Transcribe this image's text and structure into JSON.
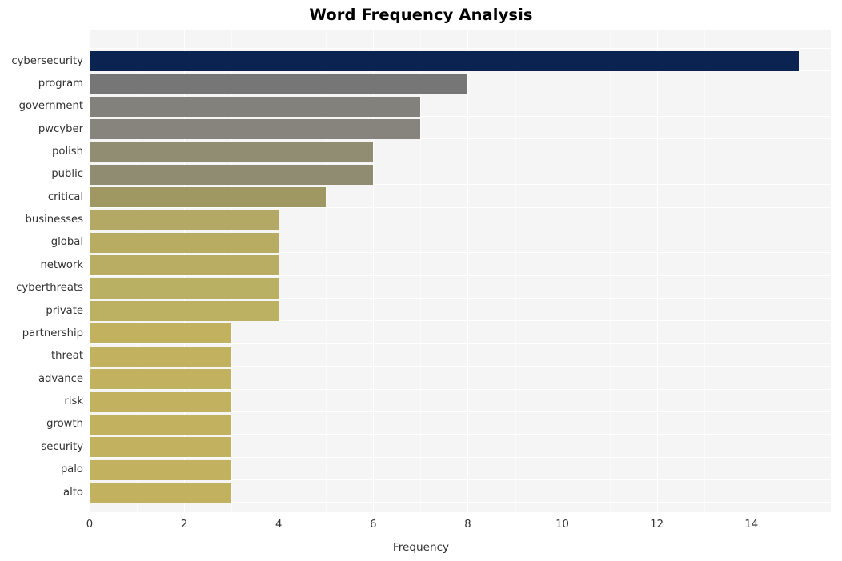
{
  "chart_data": {
    "type": "bar",
    "orientation": "horizontal",
    "title": "Word Frequency Analysis",
    "xlabel": "Frequency",
    "ylabel": "",
    "categories": [
      "cybersecurity",
      "program",
      "government",
      "pwcyber",
      "polish",
      "public",
      "critical",
      "businesses",
      "global",
      "network",
      "cyberthreats",
      "private",
      "partnership",
      "threat",
      "advance",
      "risk",
      "growth",
      "security",
      "palo",
      "alto"
    ],
    "values": [
      15,
      8,
      7,
      7,
      6,
      6,
      5,
      4,
      4,
      4,
      4,
      4,
      3,
      3,
      3,
      3,
      3,
      3,
      3,
      3
    ],
    "bar_colors": [
      "#0a2350",
      "#767676",
      "#83817b",
      "#86847c",
      "#918d72",
      "#908c72",
      "#a09862",
      "#b3a864",
      "#b8ac63",
      "#b9ad63",
      "#bab063",
      "#bcb062",
      "#c2b260",
      "#c2b260",
      "#c2b260",
      "#c2b260",
      "#c2b260",
      "#c2b260",
      "#c2b260",
      "#c2b260"
    ],
    "xlim": [
      0,
      15.68
    ],
    "xticks": [
      0,
      2,
      4,
      6,
      8,
      10,
      12,
      14
    ],
    "xtick_labels": [
      "0",
      "2",
      "4",
      "6",
      "8",
      "10",
      "12",
      "14"
    ],
    "grid": true,
    "grid_color": "#ffffff",
    "panel_background": "#f5f5f5",
    "legend": null,
    "style": "seaborn-darkgrid"
  }
}
